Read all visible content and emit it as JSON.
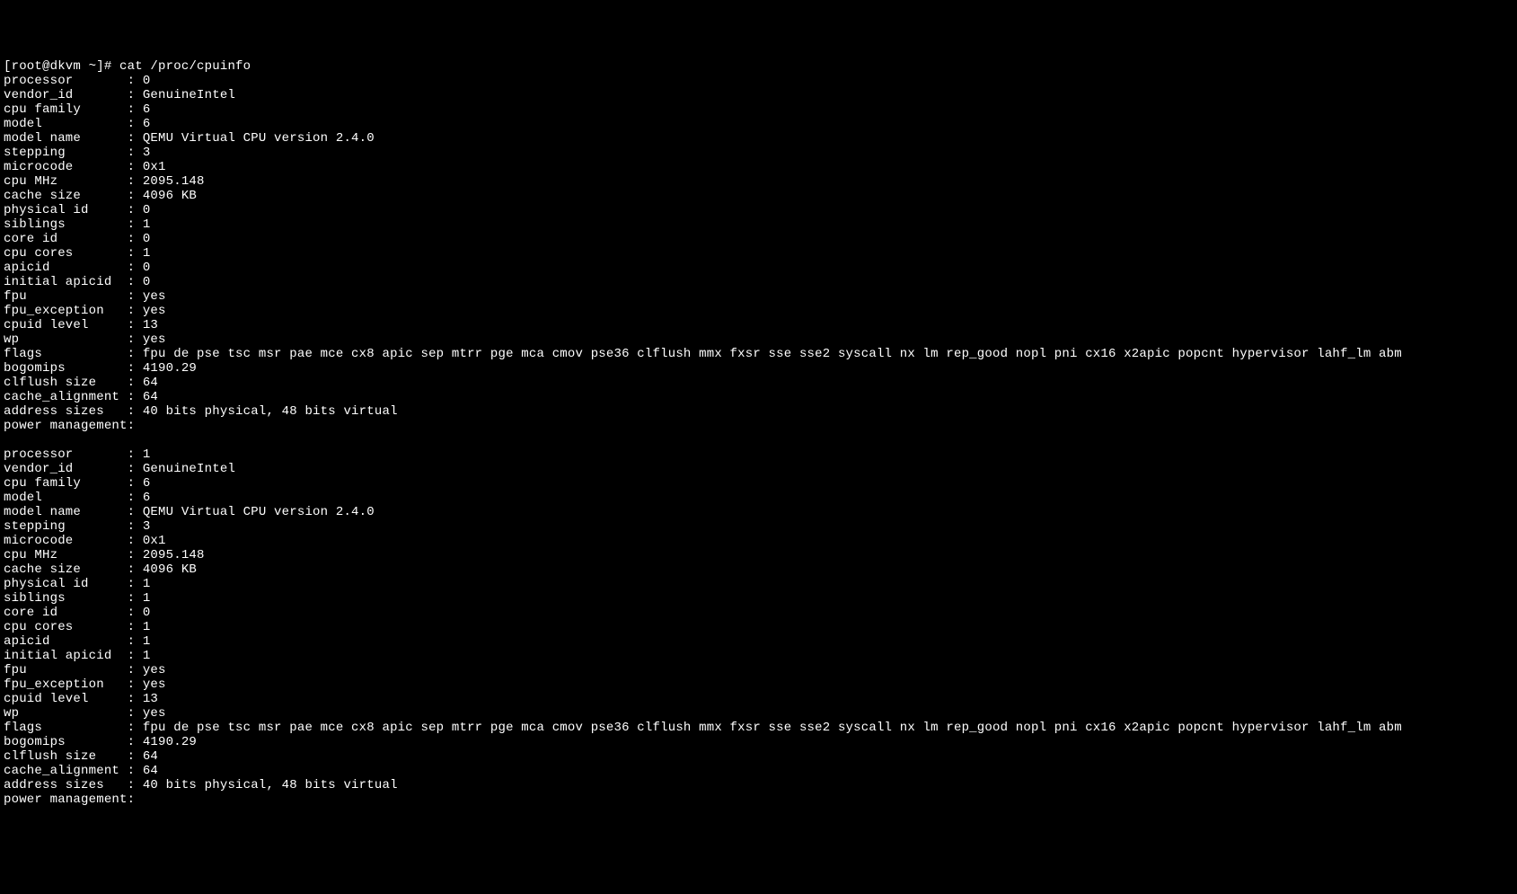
{
  "prompt": "[root@dkvm ~]# ",
  "command": "cat /proc/cpuinfo",
  "key_width": 16,
  "processors": [
    {
      "fields": [
        {
          "key": "processor",
          "value": "0"
        },
        {
          "key": "vendor_id",
          "value": "GenuineIntel"
        },
        {
          "key": "cpu family",
          "value": "6"
        },
        {
          "key": "model",
          "value": "6"
        },
        {
          "key": "model name",
          "value": "QEMU Virtual CPU version 2.4.0"
        },
        {
          "key": "stepping",
          "value": "3"
        },
        {
          "key": "microcode",
          "value": "0x1"
        },
        {
          "key": "cpu MHz",
          "value": "2095.148"
        },
        {
          "key": "cache size",
          "value": "4096 KB"
        },
        {
          "key": "physical id",
          "value": "0"
        },
        {
          "key": "siblings",
          "value": "1"
        },
        {
          "key": "core id",
          "value": "0"
        },
        {
          "key": "cpu cores",
          "value": "1"
        },
        {
          "key": "apicid",
          "value": "0"
        },
        {
          "key": "initial apicid",
          "value": "0"
        },
        {
          "key": "fpu",
          "value": "yes"
        },
        {
          "key": "fpu_exception",
          "value": "yes"
        },
        {
          "key": "cpuid level",
          "value": "13"
        },
        {
          "key": "wp",
          "value": "yes"
        },
        {
          "key": "flags",
          "value": "fpu de pse tsc msr pae mce cx8 apic sep mtrr pge mca cmov pse36 clflush mmx fxsr sse sse2 syscall nx lm rep_good nopl pni cx16 x2apic popcnt hypervisor lahf_lm abm"
        },
        {
          "key": "bogomips",
          "value": "4190.29"
        },
        {
          "key": "clflush size",
          "value": "64"
        },
        {
          "key": "cache_alignment",
          "value": "64"
        },
        {
          "key": "address sizes",
          "value": "40 bits physical, 48 bits virtual"
        },
        {
          "key": "power management",
          "value": ""
        }
      ]
    },
    {
      "fields": [
        {
          "key": "processor",
          "value": "1"
        },
        {
          "key": "vendor_id",
          "value": "GenuineIntel"
        },
        {
          "key": "cpu family",
          "value": "6"
        },
        {
          "key": "model",
          "value": "6"
        },
        {
          "key": "model name",
          "value": "QEMU Virtual CPU version 2.4.0"
        },
        {
          "key": "stepping",
          "value": "3"
        },
        {
          "key": "microcode",
          "value": "0x1"
        },
        {
          "key": "cpu MHz",
          "value": "2095.148"
        },
        {
          "key": "cache size",
          "value": "4096 KB"
        },
        {
          "key": "physical id",
          "value": "1"
        },
        {
          "key": "siblings",
          "value": "1"
        },
        {
          "key": "core id",
          "value": "0"
        },
        {
          "key": "cpu cores",
          "value": "1"
        },
        {
          "key": "apicid",
          "value": "1"
        },
        {
          "key": "initial apicid",
          "value": "1"
        },
        {
          "key": "fpu",
          "value": "yes"
        },
        {
          "key": "fpu_exception",
          "value": "yes"
        },
        {
          "key": "cpuid level",
          "value": "13"
        },
        {
          "key": "wp",
          "value": "yes"
        },
        {
          "key": "flags",
          "value": "fpu de pse tsc msr pae mce cx8 apic sep mtrr pge mca cmov pse36 clflush mmx fxsr sse sse2 syscall nx lm rep_good nopl pni cx16 x2apic popcnt hypervisor lahf_lm abm"
        },
        {
          "key": "bogomips",
          "value": "4190.29"
        },
        {
          "key": "clflush size",
          "value": "64"
        },
        {
          "key": "cache_alignment",
          "value": "64"
        },
        {
          "key": "address sizes",
          "value": "40 bits physical, 48 bits virtual"
        },
        {
          "key": "power management",
          "value": ""
        }
      ]
    }
  ]
}
